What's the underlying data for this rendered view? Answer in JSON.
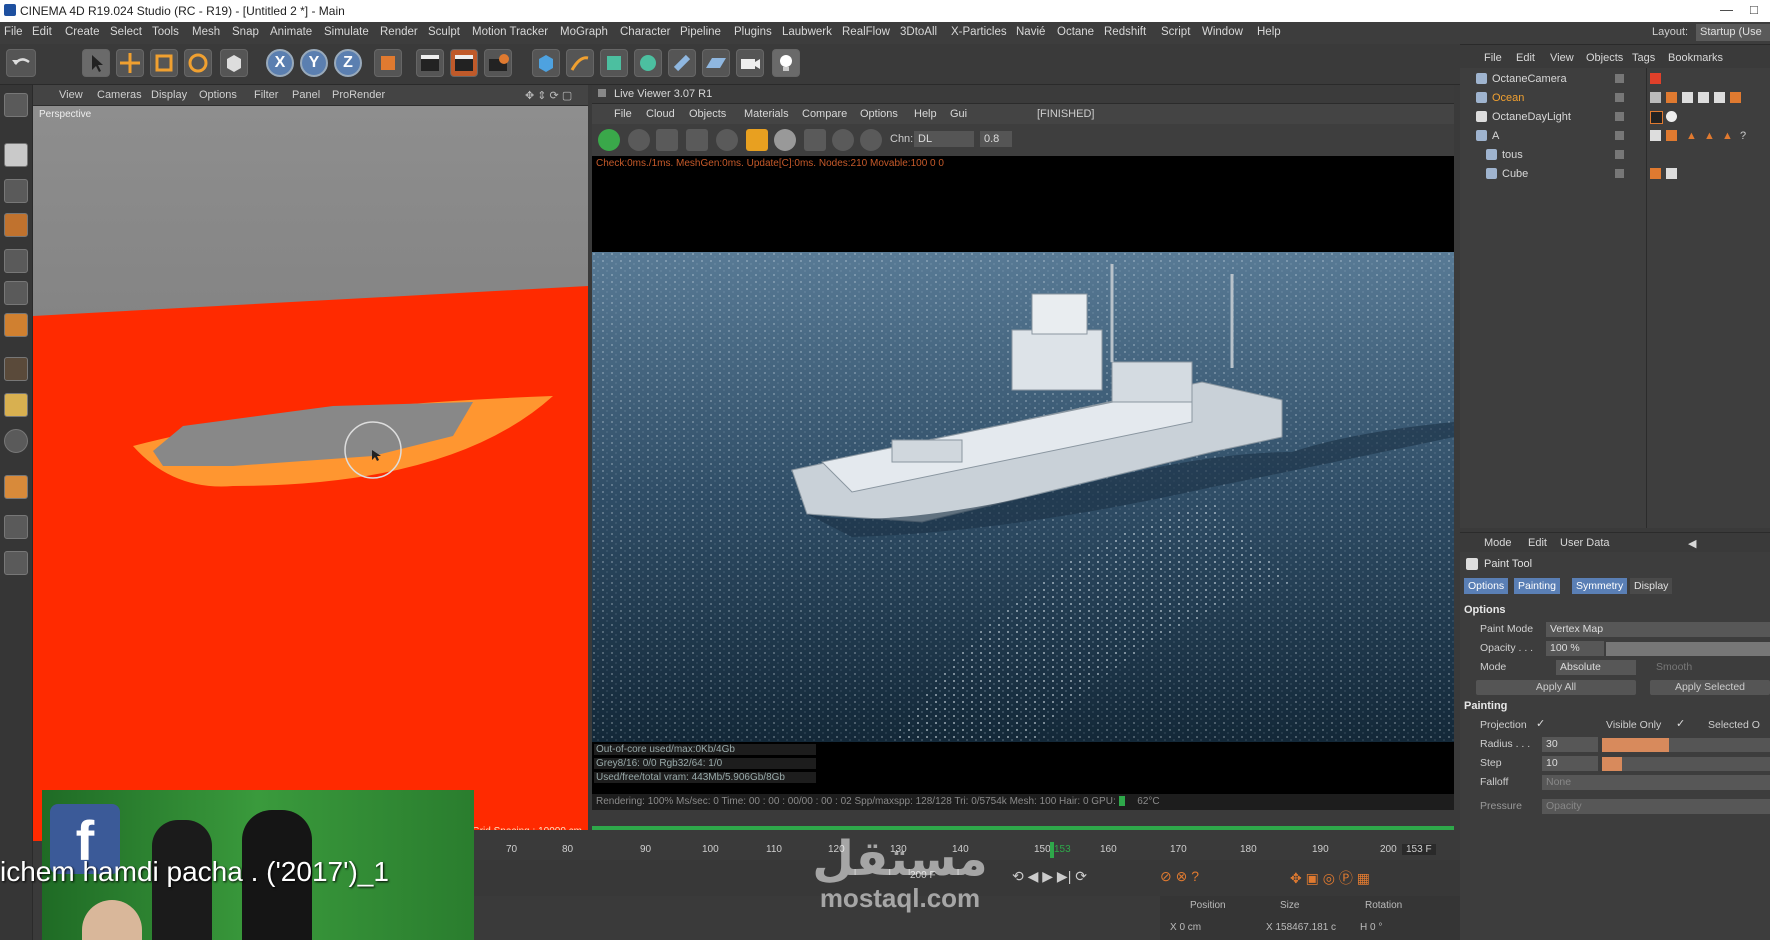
{
  "window": {
    "title": "CINEMA 4D R19.024 Studio (RC - R19) - [Untitled 2 *] - Main",
    "controls": [
      "—",
      "□"
    ]
  },
  "menubar": {
    "items": [
      "File",
      "Edit",
      "Create",
      "Select",
      "Tools",
      "Mesh",
      "Snap",
      "Animate",
      "Simulate",
      "Render",
      "Sculpt",
      "Motion Tracker",
      "MoGraph",
      "Character",
      "Pipeline",
      "Plugins",
      "Laubwerk",
      "RealFlow",
      "3DtoAll",
      "X-Particles",
      "Navié",
      "Octane",
      "Redshift",
      "Script",
      "Window",
      "Help"
    ],
    "layout_label": "Layout:",
    "layout_value": "Startup (Use"
  },
  "toolbar": {
    "axis_x": "X",
    "axis_y": "Y",
    "axis_z": "Z"
  },
  "viewport": {
    "menu": [
      "View",
      "Cameras",
      "Display",
      "Options",
      "Filter",
      "Panel",
      "ProRender"
    ],
    "label": "Perspective",
    "grid_spacing": "Grid Spacing : 10000 cm"
  },
  "live_viewer": {
    "title": "Live Viewer 3.07 R1",
    "menu": [
      "File",
      "Cloud",
      "Objects",
      "Materials",
      "Compare",
      "Options",
      "Help",
      "Gui"
    ],
    "status": "[FINISHED]",
    "chn_label": "Chn:",
    "chn_value": "DL",
    "chn_num": "0.8",
    "check_line": "Check:0ms./1ms. MeshGen:0ms. Update[C]:0ms. Nodes:210 Movable:100  0 0",
    "stats": [
      "Out-of-core used/max:0Kb/4Gb",
      "Grey8/16: 0/0        Rgb32/64: 1/0",
      "Used/free/total vram: 443Mb/5.906Gb/8Gb"
    ],
    "render_bar": "Rendering: 100%  Ms/sec: 0    Time: 00 : 00 : 00/00 : 00 : 02    Spp/maxspp: 128/128    Tri: 0/5754k    Mesh: 100    Hair: 0    GPU:",
    "gpu_temp": "62°C"
  },
  "timeline": {
    "ticks": [
      "70",
      "80",
      "90",
      "100",
      "110",
      "120",
      "130",
      "140",
      "150",
      "153",
      "160",
      "170",
      "180",
      "190",
      "200"
    ],
    "current_frame": "153 F",
    "end_frame": "200 F"
  },
  "coords": {
    "headers": [
      "Position",
      "Size",
      "Rotation"
    ],
    "x_pos": "X  0 cm",
    "x_size": "X  158467.181 c",
    "h_rot": "H  0 °"
  },
  "object_manager": {
    "menu": [
      "File",
      "Edit",
      "View",
      "Objects",
      "Tags",
      "Bookmarks"
    ],
    "objects": [
      {
        "name": "OctaneCamera",
        "highlight": false
      },
      {
        "name": "Ocean",
        "highlight": true
      },
      {
        "name": "OctaneDayLight",
        "highlight": false
      },
      {
        "name": "A",
        "highlight": false
      },
      {
        "name": "tous",
        "highlight": false
      },
      {
        "name": "Cube",
        "highlight": false
      }
    ]
  },
  "attribute_manager": {
    "menu": [
      "Mode",
      "Edit",
      "User Data"
    ],
    "tool_name": "Paint Tool",
    "tabs": [
      "Options",
      "Painting",
      "Symmetry",
      "Display"
    ],
    "options_title": "Options",
    "paint_mode_label": "Paint Mode",
    "paint_mode_value": "Vertex Map",
    "opacity_label": "Opacity . . .",
    "opacity_value": "100 %",
    "mode_label": "Mode",
    "mode_value": "Absolute",
    "smooth_label": "Smooth",
    "apply_all": "Apply All",
    "apply_selected": "Apply Selected",
    "painting_title": "Painting",
    "projection_label": "Projection",
    "visible_only_label": "Visible Only",
    "selected_label": "Selected O",
    "radius_label": "Radius . . .",
    "radius_value": "30",
    "radius_fraction": 0.4,
    "step_label": "Step",
    "step_value": "10",
    "step_fraction": 0.12,
    "falloff_label": "Falloff",
    "falloff_value": "None",
    "pressure_label": "Pressure",
    "pressure_value": "Opacity"
  },
  "overlays": {
    "caption": "ichem hamdi pacha . ('2017')_1",
    "watermark_arabic": "مستقل",
    "watermark_latin": "mostaql.com",
    "facebook_letter": "f"
  },
  "colors": {
    "accent_blue": "#5a7fb5",
    "red_vertexmap": "#ff2a00",
    "gpu_green": "#2ea84a",
    "status_orange": "#c65a2a"
  }
}
